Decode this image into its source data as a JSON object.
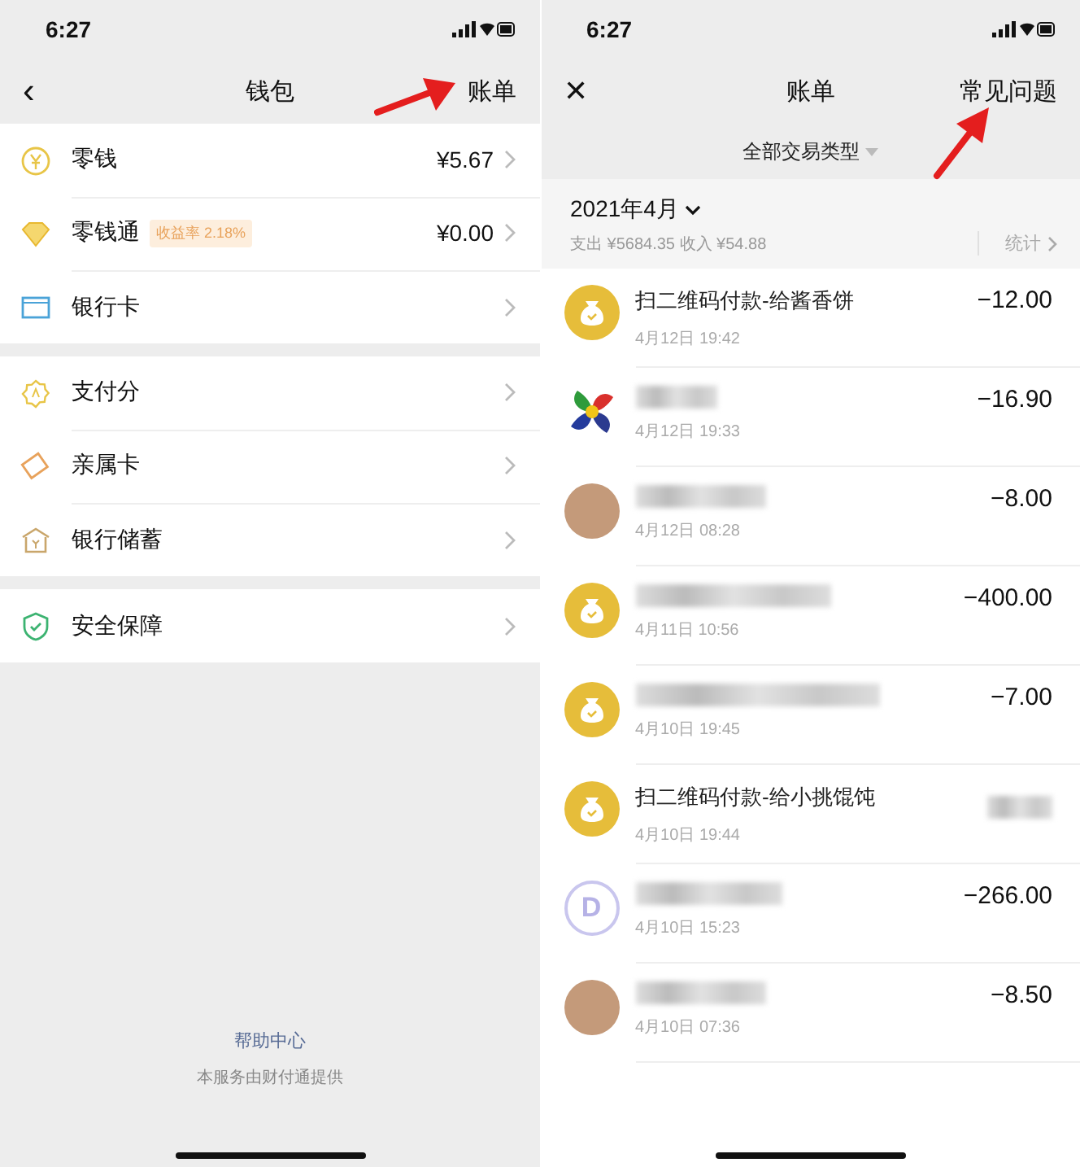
{
  "wallet": {
    "status_bar": {
      "time": "6:27"
    },
    "nav": {
      "back": "‹",
      "title": "钱包",
      "action": "账单"
    },
    "sections": [
      {
        "items": [
          {
            "kind": "yen",
            "label": "零钱",
            "value": "¥5.67"
          },
          {
            "kind": "diamond",
            "label": "零钱通",
            "badge": "收益率 2.18%",
            "value": "¥0.00"
          },
          {
            "kind": "card",
            "label": "银行卡"
          }
        ]
      },
      {
        "items": [
          {
            "kind": "score",
            "label": "支付分"
          },
          {
            "kind": "family",
            "label": "亲属卡"
          },
          {
            "kind": "bank",
            "label": "银行储蓄"
          }
        ]
      },
      {
        "items": [
          {
            "kind": "shield",
            "label": "安全保障"
          }
        ]
      }
    ],
    "footer": {
      "link": "帮助中心",
      "note": "本服务由财付通提供"
    }
  },
  "bills": {
    "status_bar": {
      "time": "6:27"
    },
    "nav": {
      "close": "✕",
      "title": "账单",
      "action": "常见问题"
    },
    "filter": "全部交易类型",
    "month": {
      "label": "2021年4月",
      "summary": "支出 ¥5684.35 收入 ¥54.88",
      "stats": "统计"
    },
    "transactions": [
      {
        "kind": "bag",
        "title": "扫二维码付款-给酱香饼",
        "date": "4月12日 19:42",
        "amount": "−12.00"
      },
      {
        "kind": "pinwheel",
        "date": "4月12日 19:33",
        "amount": "−16.90"
      },
      {
        "kind": "cartoon",
        "date": "4月12日 08:28",
        "amount": "−8.00"
      },
      {
        "kind": "bag",
        "date": "4月11日 10:56",
        "amount": "−400.00"
      },
      {
        "kind": "bag",
        "date": "4月10日 19:45",
        "amount": "−7.00"
      },
      {
        "kind": "bag",
        "title": "扫二维码付款-给小挑馄饨",
        "date": "4月10日 19:44"
      },
      {
        "kind": "letter",
        "letter": "D",
        "date": "4月10日 15:23",
        "amount": "−266.00"
      },
      {
        "kind": "cartoon",
        "date": "4月10日 07:36",
        "amount": "−8.50"
      }
    ]
  }
}
